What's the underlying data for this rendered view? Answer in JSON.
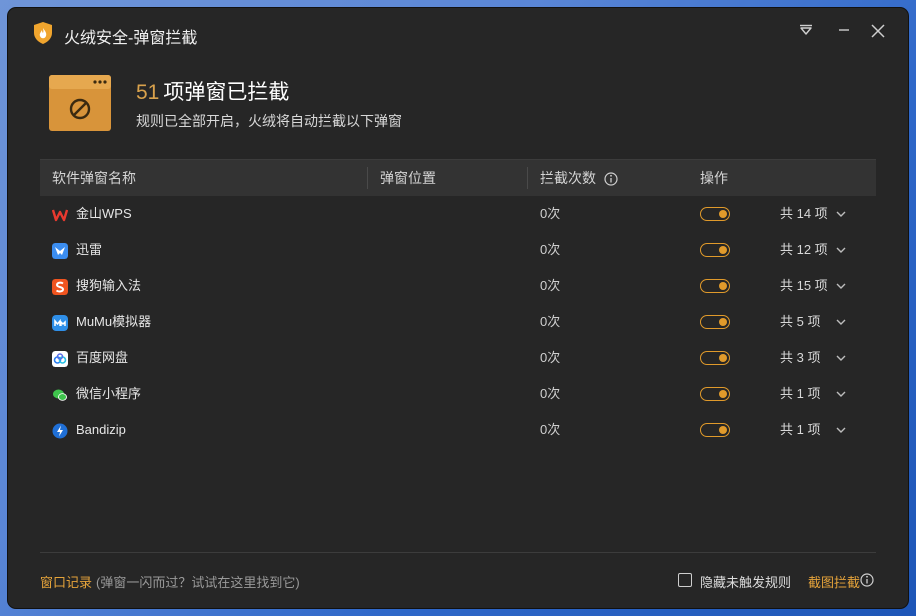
{
  "window": {
    "title": "火绒安全-弹窗拦截"
  },
  "summary": {
    "count": "51",
    "headline": "项弹窗已拦截",
    "subline": "规则已全部开启，火绒将自动拦截以下弹窗"
  },
  "table": {
    "columns": [
      "软件弹窗名称",
      "弹窗位置",
      "拦截次数",
      "操作"
    ],
    "rows": [
      {
        "name": "金山WPS",
        "icon": "wps-icon",
        "count": "0次",
        "enabled": true,
        "rules": "共 14 项"
      },
      {
        "name": "迅雷",
        "icon": "xunlei-icon",
        "count": "0次",
        "enabled": true,
        "rules": "共 12 项"
      },
      {
        "name": "搜狗输入法",
        "icon": "sogou-icon",
        "count": "0次",
        "enabled": true,
        "rules": "共 15 项"
      },
      {
        "name": "MuMu模拟器",
        "icon": "mumu-icon",
        "count": "0次",
        "enabled": true,
        "rules": "共 5 项"
      },
      {
        "name": "百度网盘",
        "icon": "baidu-netdisk-icon",
        "count": "0次",
        "enabled": true,
        "rules": "共 3 项"
      },
      {
        "name": "微信小程序",
        "icon": "wechat-icon",
        "count": "0次",
        "enabled": true,
        "rules": "共 1 项"
      },
      {
        "name": "Bandizip",
        "icon": "bandizip-icon",
        "count": "0次",
        "enabled": true,
        "rules": "共 1 项"
      }
    ]
  },
  "footer": {
    "history_link": "窗口记录",
    "history_hint": "(弹窗一闪而过？试试在这里找到它)",
    "hide_rules_label": "隐藏未触发规则",
    "capture_link": "截图拦截"
  },
  "colors": {
    "accent": "#e09a2b",
    "background": "#262626",
    "header": "#333333"
  }
}
